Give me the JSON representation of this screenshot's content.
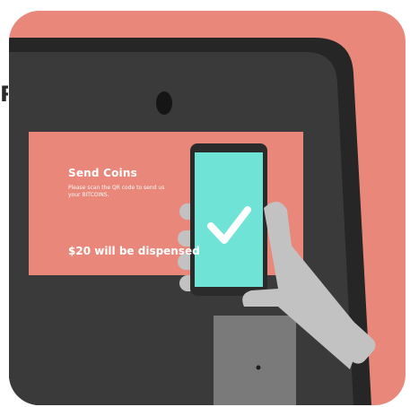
{
  "cut_letter": "R",
  "screen": {
    "title": "Send Coins",
    "instructions": "Please scan the QR code to send us your BITCOINS.",
    "amount": "$20 will be dispensed"
  },
  "colors": {
    "background": "#E8877A",
    "machine": "#3A3A3A",
    "machine_outline": "#262626",
    "screen": "#E8877A",
    "phone_body": "#2B2B2B",
    "phone_screen": "#6FE3D6",
    "hand": "#C2C2C2",
    "dispenser": "#7A7A7A"
  },
  "icons": {
    "phone_check": "checkmark-icon"
  }
}
